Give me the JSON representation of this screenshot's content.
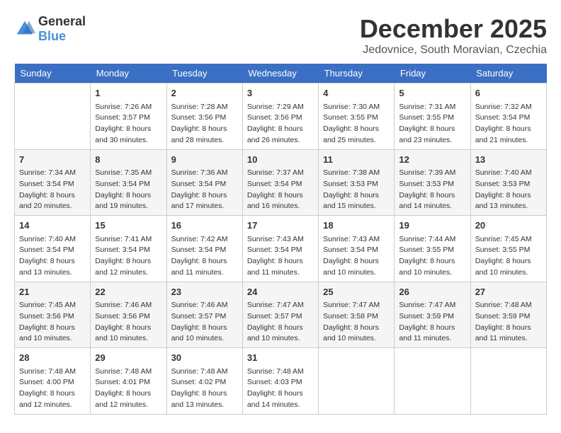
{
  "header": {
    "logo_general": "General",
    "logo_blue": "Blue",
    "month_year": "December 2025",
    "location": "Jedovnice, South Moravian, Czechia"
  },
  "weekdays": [
    "Sunday",
    "Monday",
    "Tuesday",
    "Wednesday",
    "Thursday",
    "Friday",
    "Saturday"
  ],
  "weeks": [
    [
      {
        "day": "",
        "content": ""
      },
      {
        "day": "1",
        "content": "Sunrise: 7:26 AM\nSunset: 3:57 PM\nDaylight: 8 hours\nand 30 minutes."
      },
      {
        "day": "2",
        "content": "Sunrise: 7:28 AM\nSunset: 3:56 PM\nDaylight: 8 hours\nand 28 minutes."
      },
      {
        "day": "3",
        "content": "Sunrise: 7:29 AM\nSunset: 3:56 PM\nDaylight: 8 hours\nand 26 minutes."
      },
      {
        "day": "4",
        "content": "Sunrise: 7:30 AM\nSunset: 3:55 PM\nDaylight: 8 hours\nand 25 minutes."
      },
      {
        "day": "5",
        "content": "Sunrise: 7:31 AM\nSunset: 3:55 PM\nDaylight: 8 hours\nand 23 minutes."
      },
      {
        "day": "6",
        "content": "Sunrise: 7:32 AM\nSunset: 3:54 PM\nDaylight: 8 hours\nand 21 minutes."
      }
    ],
    [
      {
        "day": "7",
        "content": "Sunrise: 7:34 AM\nSunset: 3:54 PM\nDaylight: 8 hours\nand 20 minutes."
      },
      {
        "day": "8",
        "content": "Sunrise: 7:35 AM\nSunset: 3:54 PM\nDaylight: 8 hours\nand 19 minutes."
      },
      {
        "day": "9",
        "content": "Sunrise: 7:36 AM\nSunset: 3:54 PM\nDaylight: 8 hours\nand 17 minutes."
      },
      {
        "day": "10",
        "content": "Sunrise: 7:37 AM\nSunset: 3:54 PM\nDaylight: 8 hours\nand 16 minutes."
      },
      {
        "day": "11",
        "content": "Sunrise: 7:38 AM\nSunset: 3:53 PM\nDaylight: 8 hours\nand 15 minutes."
      },
      {
        "day": "12",
        "content": "Sunrise: 7:39 AM\nSunset: 3:53 PM\nDaylight: 8 hours\nand 14 minutes."
      },
      {
        "day": "13",
        "content": "Sunrise: 7:40 AM\nSunset: 3:53 PM\nDaylight: 8 hours\nand 13 minutes."
      }
    ],
    [
      {
        "day": "14",
        "content": "Sunrise: 7:40 AM\nSunset: 3:54 PM\nDaylight: 8 hours\nand 13 minutes."
      },
      {
        "day": "15",
        "content": "Sunrise: 7:41 AM\nSunset: 3:54 PM\nDaylight: 8 hours\nand 12 minutes."
      },
      {
        "day": "16",
        "content": "Sunrise: 7:42 AM\nSunset: 3:54 PM\nDaylight: 8 hours\nand 11 minutes."
      },
      {
        "day": "17",
        "content": "Sunrise: 7:43 AM\nSunset: 3:54 PM\nDaylight: 8 hours\nand 11 minutes."
      },
      {
        "day": "18",
        "content": "Sunrise: 7:43 AM\nSunset: 3:54 PM\nDaylight: 8 hours\nand 10 minutes."
      },
      {
        "day": "19",
        "content": "Sunrise: 7:44 AM\nSunset: 3:55 PM\nDaylight: 8 hours\nand 10 minutes."
      },
      {
        "day": "20",
        "content": "Sunrise: 7:45 AM\nSunset: 3:55 PM\nDaylight: 8 hours\nand 10 minutes."
      }
    ],
    [
      {
        "day": "21",
        "content": "Sunrise: 7:45 AM\nSunset: 3:56 PM\nDaylight: 8 hours\nand 10 minutes."
      },
      {
        "day": "22",
        "content": "Sunrise: 7:46 AM\nSunset: 3:56 PM\nDaylight: 8 hours\nand 10 minutes."
      },
      {
        "day": "23",
        "content": "Sunrise: 7:46 AM\nSunset: 3:57 PM\nDaylight: 8 hours\nand 10 minutes."
      },
      {
        "day": "24",
        "content": "Sunrise: 7:47 AM\nSunset: 3:57 PM\nDaylight: 8 hours\nand 10 minutes."
      },
      {
        "day": "25",
        "content": "Sunrise: 7:47 AM\nSunset: 3:58 PM\nDaylight: 8 hours\nand 10 minutes."
      },
      {
        "day": "26",
        "content": "Sunrise: 7:47 AM\nSunset: 3:59 PM\nDaylight: 8 hours\nand 11 minutes."
      },
      {
        "day": "27",
        "content": "Sunrise: 7:48 AM\nSunset: 3:59 PM\nDaylight: 8 hours\nand 11 minutes."
      }
    ],
    [
      {
        "day": "28",
        "content": "Sunrise: 7:48 AM\nSunset: 4:00 PM\nDaylight: 8 hours\nand 12 minutes."
      },
      {
        "day": "29",
        "content": "Sunrise: 7:48 AM\nSunset: 4:01 PM\nDaylight: 8 hours\nand 12 minutes."
      },
      {
        "day": "30",
        "content": "Sunrise: 7:48 AM\nSunset: 4:02 PM\nDaylight: 8 hours\nand 13 minutes."
      },
      {
        "day": "31",
        "content": "Sunrise: 7:48 AM\nSunset: 4:03 PM\nDaylight: 8 hours\nand 14 minutes."
      },
      {
        "day": "",
        "content": ""
      },
      {
        "day": "",
        "content": ""
      },
      {
        "day": "",
        "content": ""
      }
    ]
  ]
}
